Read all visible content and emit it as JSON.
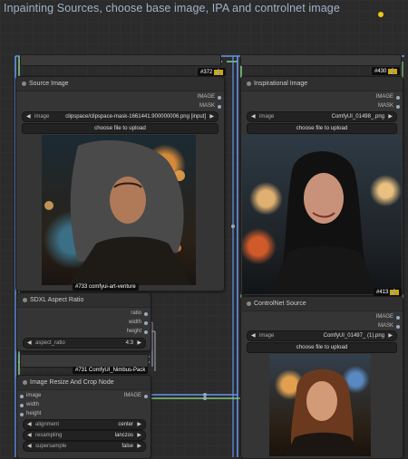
{
  "group": {
    "title": "Inpainting Sources, choose base image, IPA and controlnet image"
  },
  "reroute_nodes": {
    "left_id": "#372",
    "right_id": "#430"
  },
  "source_image": {
    "title": "Source Image",
    "outputs": [
      "IMAGE",
      "MASK"
    ],
    "widget_label": "image",
    "widget_value": "clipspace/clipspace-mask-1661441.900000006.png [input]",
    "upload_label": "choose file to upload",
    "tag": "#733 comfyui-art-venture"
  },
  "inspirational_image": {
    "title": "Inspirational Image",
    "outputs": [
      "IMAGE",
      "MASK"
    ],
    "widget_label": "image",
    "widget_value": "ComfyUI_01498_.png",
    "upload_label": "choose file to upload",
    "tag": "#413"
  },
  "aspect_ratio": {
    "title": "SDXL Aspect Ratio",
    "outputs": [
      "ratio",
      "width",
      "height"
    ],
    "widget_label": "aspect_ratio",
    "widget_value": "4:3"
  },
  "nimbus_tag": "#731 ComfyUI_Nimbus-Pack",
  "resize_node": {
    "title": "Image Resize And Crop Node",
    "inputs": [
      "image",
      "width",
      "height"
    ],
    "output": "IMAGE",
    "widgets": [
      {
        "label": "alignment",
        "value": "center"
      },
      {
        "label": "resampling",
        "value": "lanczos"
      },
      {
        "label": "supersample",
        "value": "false"
      }
    ]
  },
  "controlnet_source": {
    "title": "ControlNet Source",
    "outputs": [
      "IMAGE",
      "MASK"
    ],
    "widget_label": "image",
    "widget_value": "ComfyUI_01497_ (1).png",
    "upload_label": "choose file to upload"
  },
  "colors": {
    "wire_blue": "#6495ed",
    "wire_green": "#7fc97f",
    "accent_yellow": "#f0c419"
  }
}
